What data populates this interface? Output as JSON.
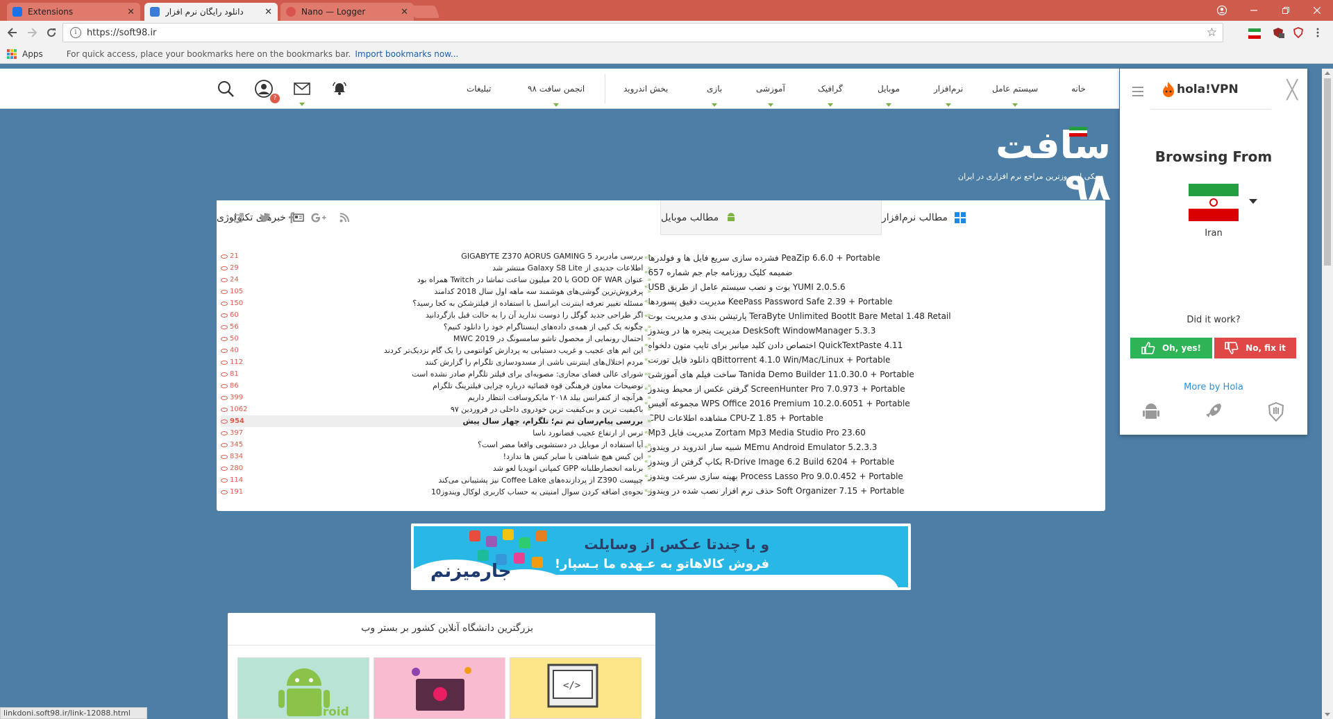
{
  "browser": {
    "tabs": [
      {
        "title": "Extensions",
        "favicon": "puzzle-icon",
        "color": "#1a73e8"
      },
      {
        "title": "دانلود رایگان نرم افزار",
        "favicon": "soft98-icon",
        "color": "#3a7bd5"
      },
      {
        "title": "Nano — Logger",
        "favicon": "nano-icon",
        "color": "#d9534f"
      }
    ],
    "tab_close_glyph": "✕",
    "url": "https://soft98.ir",
    "bookmarks": {
      "apps_label": "Apps",
      "hint": "For quick access, place your bookmarks here on the bookmarks bar.",
      "import_link": "Import bookmarks now..."
    },
    "status_url": "linkdoni.soft98.ir/link-12088.html"
  },
  "site": {
    "nav": [
      {
        "label": "خانه",
        "caret": false
      },
      {
        "label": "سیستم عامل",
        "caret": true
      },
      {
        "label": "نرم‌افزار",
        "caret": true
      },
      {
        "label": "موبایل",
        "caret": true
      },
      {
        "label": "گرافیک",
        "caret": true
      },
      {
        "label": "آموزشی",
        "caret": true
      },
      {
        "label": "بازی",
        "caret": true
      },
      {
        "label": "بخش اندروید",
        "caret": false
      },
      {
        "label": "انجمن سافت ۹۸",
        "caret": true
      },
      {
        "label": "تبلیغات",
        "caret": false
      }
    ],
    "logo_text": "سافت ۹۸",
    "tagline": "یکی از بروزترین مراجع نرم افزاری در ایران",
    "tabs": {
      "software": "مطالب نرم‌افزار",
      "mobile": "مطالب موبایل",
      "news": "خبرهای تکنولوژی"
    },
    "software_list": [
      "PeaZip 6.6.0 + Portable فشرده سازی سریع فایل ها و فولدرها",
      "ضمیمه کلیک روزنامه جام جم شماره 657",
      "YUMI 2.0.5.6 بوت و نصب سیستم عامل از طریق USB",
      "KeePass Password Safe 2.39 + Portable مدیریت دقیق پسوردها",
      "TeraByte Unlimited BootIt Bare Metal 1.48 Retail پارتیشن بندی و مدیریت بوت",
      "DeskSoft WindowManager 5.3.3 مدیریت پنجره ها در ویندوز",
      "QuickTextPaste 4.11 اختصاص دادن کلید میانبر برای تایپ متون دلخواه",
      "qBittorrent 4.1.0 Win/Mac/Linux + Portable دانلود فایل تورنت",
      "Tanida Demo Builder 11.0.30.0 + Portable ساخت فیلم های آموزشی",
      "ScreenHunter Pro 7.0.973 + Portable گرفتن عکس از محیط ویندوز",
      "WPS Office 2016 Premium 10.2.0.6051 + Portable مجموعه آفیس",
      "CPU-Z 1.85 + Portable مشاهده اطلاعات CPU",
      "Zortam Mp3 Media Studio Pro 23.60 مدیریت فایل Mp3",
      "MEmu Android Emulator 5.2.3.3 شبیه ساز اندروید در ویندوز",
      "R-Drive Image 6.2 Build 6204 + Portable بکاپ گرفتن از ویندوز",
      "Process Lasso Pro 9.0.0.452 + Portable بهینه سازی سرعت ویندوز",
      "Soft Organizer 7.15 + Portable حذف نرم افزار نصب شده در ویندوز"
    ],
    "news_list": [
      {
        "views": "21",
        "title": "بررسی مادربرد GIGABYTE Z370 AORUS GAMING 5"
      },
      {
        "views": "29",
        "title": "اطلاعات جدیدی از Galaxy S8 Lite منتشر شد"
      },
      {
        "views": "24",
        "title": "عنوان GOD OF WAR با 20 میلیون ساعت تماشا در Twitch همراه بود"
      },
      {
        "views": "105",
        "title": "پرفروش‌ترین گوشی‌های هوشمند سه ماهه اول سال 2018 کدامند"
      },
      {
        "views": "150",
        "title": "مسئله تغییر تعرفه اینترنت ایرانسل با استفاده از فیلترشکن به کجا رسید؟"
      },
      {
        "views": "60",
        "title": "اگر طراحی جدید گوگل را دوست ندارید آن را به حالت قبل بازگردانید"
      },
      {
        "views": "56",
        "title": "چگونه یک کپی از همه‌ی داده‌های اینستاگرام خود را دانلود کنیم؟"
      },
      {
        "views": "50",
        "title": "احتمال رونمایی از محصول تاشو سامسونگ در MWC 2019"
      },
      {
        "views": "40",
        "title": "این اتم های عجیب و غریب دستیابی به پردازش کوانتومی را یک گام نزدیک‌تر کردند"
      },
      {
        "views": "112",
        "title": "مردم اختلال‌های اینترنتی ناشی از مسدودسازی تلگرام را گزارش کنند"
      },
      {
        "views": "81",
        "title": "شورای عالی فضای مجازی: مصوبه‌ای برای فیلتر تلگرام صادر نشده است"
      },
      {
        "views": "86",
        "title": "توضیحات معاون فرهنگی قوه قضائیه درباره چرایی فیلترینگ تلگرام"
      },
      {
        "views": "399",
        "title": "هرآنچه از کنفرانس بیلد ۲۰۱۸ مایکروسافت انتظار داریم"
      },
      {
        "views": "1062",
        "title": "باکیفیت ترین و بی‌کیفیت ترین خودروی داخلی در فروردین ۹۷"
      },
      {
        "views": "954",
        "title": "بررسی پیام‌رسان تم تم؛ تلگرام، چهار سال پیش",
        "highlight": true
      },
      {
        "views": "397",
        "title": "ترس از ارتفاع عجیب فضانورد ناسا"
      },
      {
        "views": "345",
        "title": "آیا استفاده از موبایل در دستشویی واقعا مضر است؟"
      },
      {
        "views": "834",
        "title": "این کیس هیچ شباهتی با سایر کیس ها ندارد!"
      },
      {
        "views": "280",
        "title": "برنامه انحصارطلبانه GPP کمپانی انویدیا لغو شد"
      },
      {
        "views": "114",
        "title": "چیپست Z390 از پردازنده‌های Coffee Lake نیز پشتیبانی می‌کند"
      },
      {
        "views": "191",
        "title": "نحوه‌ی اضافه کردن سوال امنیتی به حساب کاربری لوکال ویندوز10"
      }
    ],
    "banner": {
      "line1": "و با چندتا عـکس از وسایلت",
      "line2": "فروش کالاهاتو به عـهده ما بـسپار!",
      "brand": "جارمیزنم"
    },
    "uni_card_title": "بزرگترین دانشگاه آنلاین کشور بر بستر وب",
    "thumb_label": "android",
    "profile_badge": "?"
  },
  "hola": {
    "brand": "hola!VPN",
    "browsing_from": "Browsing From",
    "country": "Iran",
    "question": "Did it work?",
    "yes_label": "Oh, yes!",
    "no_label": "No, fix it",
    "more_label": "More by Hola",
    "close_glyph": "╳"
  },
  "colors": {
    "accent_green": "#7cb342",
    "page_bg": "#4d7ea6",
    "chrome_red": "#cf5b4c",
    "views_red": "#e05a4a"
  }
}
